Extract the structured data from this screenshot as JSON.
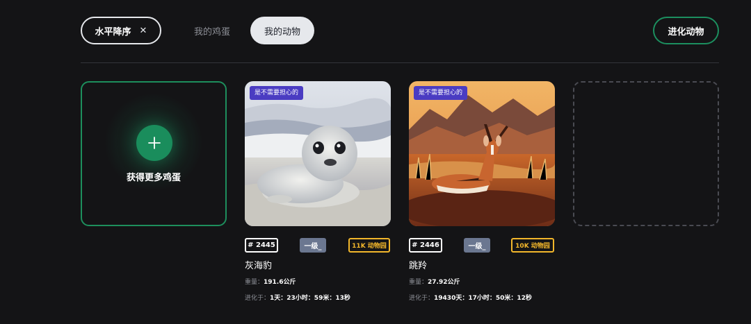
{
  "toolbar": {
    "sort_label": "水平降序",
    "sort_clear": "✕",
    "tab_eggs": "我的鸡蛋",
    "tab_animals": "我的动物",
    "evolve_label": "进化动物"
  },
  "add_card": {
    "label": "获得更多鸡蛋",
    "icon": "plus-icon"
  },
  "animals": [
    {
      "badge": "是不需要担心的",
      "id": "# 2445",
      "level": "一级_",
      "zoo": "11K 动物园",
      "name": "灰海豹",
      "weight_label": "重量：",
      "weight": "191.6公斤",
      "evolve_label": "进化于：",
      "evolve_time": "1天：23小时：59米：13秒"
    },
    {
      "badge": "是不需要担心的",
      "id": "# 2446",
      "level": "一级_",
      "zoo": "10K 动物园",
      "name": "跳羚",
      "weight_label": "重量：",
      "weight": "27.92公斤",
      "evolve_label": "进化于：",
      "evolve_time": "19430天：17小时：50米：12秒"
    }
  ],
  "colors": {
    "background": "#141416",
    "accent_green": "#1a8d5c",
    "badge_purple": "#4a3cc2",
    "zoo_yellow": "#f3b72b"
  }
}
